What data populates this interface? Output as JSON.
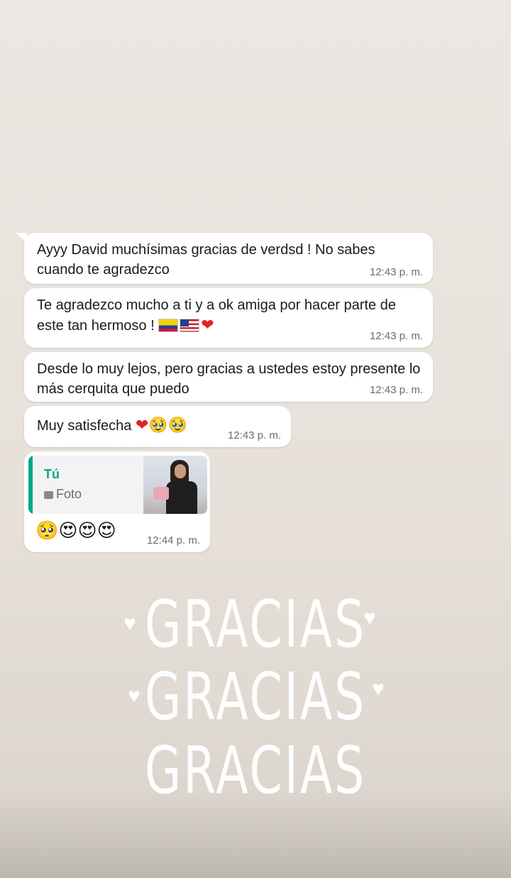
{
  "messages": [
    {
      "text": "Ayyy David muchísimas gracias de verdsd ! No sabes cuando te agradezco",
      "time": "12:43 p. m."
    },
    {
      "text": "Te agradezco mucho a ti y a ok amiga por hacer parte de este tan hermoso !",
      "time": "12:43 p. m."
    },
    {
      "text": "Desde lo muy lejos, pero gracias a ustedes estoy presente lo más cerquita que puedo",
      "time": "12:43 p. m."
    },
    {
      "text": "Muy satisfecha",
      "time": "12:43 p. m."
    },
    {
      "quote_author": "Tú",
      "quote_type": "Foto",
      "text": "🥺😍😍😍",
      "time": "12:44 p. m."
    }
  ],
  "message2_trailing_emoji": "🇨🇴🇺🇸❤️",
  "message4_trailing_emoji": "❤️🥹🥹",
  "overlay": {
    "words": [
      "GRACIAS",
      "GRACIAS",
      "GRACIAS"
    ],
    "heart_glyph": "♥"
  },
  "icons": [
    "photo-icon",
    "heart-icon"
  ],
  "colors": {
    "bubble": "#ffffff",
    "quote_accent": "#06a884",
    "timestamp": "#6b6b6b"
  }
}
